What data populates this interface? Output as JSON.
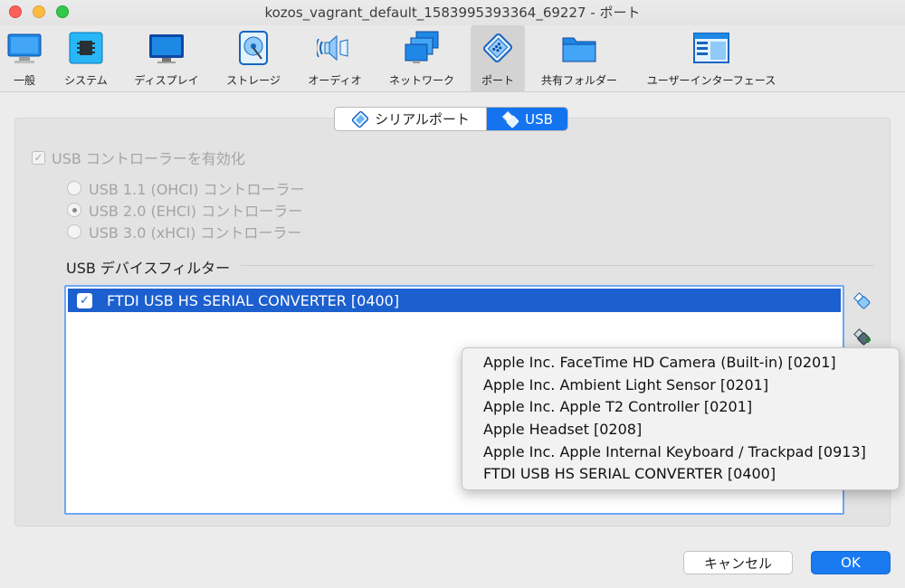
{
  "window": {
    "title": "kozos_vagrant_default_1583995393364_69227 - ポート"
  },
  "toolbar": {
    "items": [
      {
        "label": "一般",
        "icon": "monitor-icon"
      },
      {
        "label": "システム",
        "icon": "chip-icon"
      },
      {
        "label": "ディスプレイ",
        "icon": "display-icon"
      },
      {
        "label": "ストレージ",
        "icon": "disk-icon"
      },
      {
        "label": "オーディオ",
        "icon": "speaker-icon"
      },
      {
        "label": "ネットワーク",
        "icon": "network-icon"
      },
      {
        "label": "ポート",
        "icon": "port-icon",
        "active": true
      },
      {
        "label": "共有フォルダー",
        "icon": "folder-icon"
      },
      {
        "label": "ユーザーインターフェース",
        "icon": "ui-window-icon"
      }
    ]
  },
  "tabs": {
    "serial": "シリアルポート",
    "usb": "USB",
    "active": "usb"
  },
  "usb": {
    "enable_label": "USB コントローラーを有効化",
    "enable_checked": true,
    "controllers": [
      {
        "label": "USB 1.1 (OHCI) コントローラー",
        "selected": false
      },
      {
        "label": "USB 2.0 (EHCI) コントローラー",
        "selected": true
      },
      {
        "label": "USB 3.0 (xHCI) コントローラー",
        "selected": false
      }
    ],
    "filter_label": "USB デバイスフィルター",
    "filters": [
      {
        "label": "FTDI USB HS SERIAL CONVERTER [0400]",
        "checked": true
      }
    ]
  },
  "popup_menu": {
    "items": [
      "Apple Inc. FaceTime HD Camera (Built-in) [0201]",
      "Apple Inc. Ambient Light Sensor [0201]",
      "Apple Inc. Apple T2 Controller [0201]",
      "Apple Headset [0208]",
      "Apple Inc. Apple Internal Keyboard / Trackpad [0913]",
      "FTDI USB HS SERIAL CONVERTER [0400]"
    ]
  },
  "buttons": {
    "cancel": "キャンセル",
    "ok": "OK"
  },
  "colors": {
    "accent": "#1a7bf0",
    "selection": "#1c5fcf"
  }
}
